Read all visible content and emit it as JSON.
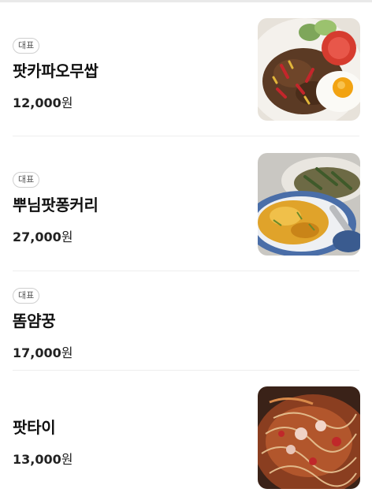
{
  "menu": {
    "items": [
      {
        "badge": "대표",
        "name": "팟카파오무쌉",
        "price": "12,000",
        "unit": "원",
        "image": "pad-kra-pao-photo"
      },
      {
        "badge": "대표",
        "name": "뿌님팟퐁커리",
        "price": "27,000",
        "unit": "원",
        "image": "crab-curry-photo"
      },
      {
        "badge": "대표",
        "name": "똠얌꿍",
        "price": "17,000",
        "unit": "원"
      },
      {
        "badge": "",
        "name": "팟타이",
        "price": "13,000",
        "unit": "원",
        "image": "pad-thai-photo"
      }
    ]
  }
}
